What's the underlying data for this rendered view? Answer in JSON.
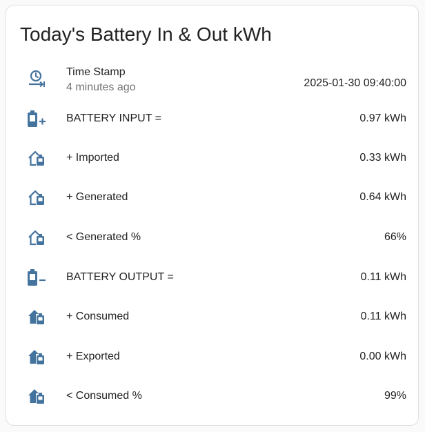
{
  "card": {
    "title": "Today's Battery In & Out kWh",
    "icon_color": "#44739e"
  },
  "rows": [
    {
      "icon": "clock-arrow-icon",
      "name": "Time Stamp",
      "secondary": "4 minutes ago",
      "state": "2025-01-30 09:40:00"
    },
    {
      "icon": "battery-plus-icon",
      "name": "BATTERY INPUT =",
      "state": "0.97 kWh"
    },
    {
      "icon": "home-battery-outline-icon",
      "name": "+ Imported",
      "state": "0.33 kWh"
    },
    {
      "icon": "home-battery-outline-icon",
      "name": "+ Generated",
      "state": "0.64 kWh"
    },
    {
      "icon": "home-battery-outline-icon",
      "name": "< Generated %",
      "state": "66%"
    },
    {
      "icon": "battery-minus-icon",
      "name": "BATTERY OUTPUT =",
      "state": "0.11 kWh"
    },
    {
      "icon": "home-battery-icon",
      "name": "+ Consumed",
      "state": "0.11 kWh"
    },
    {
      "icon": "home-battery-icon",
      "name": "+ Exported",
      "state": "0.00 kWh"
    },
    {
      "icon": "home-battery-icon",
      "name": "< Consumed %",
      "state": "99%"
    }
  ]
}
